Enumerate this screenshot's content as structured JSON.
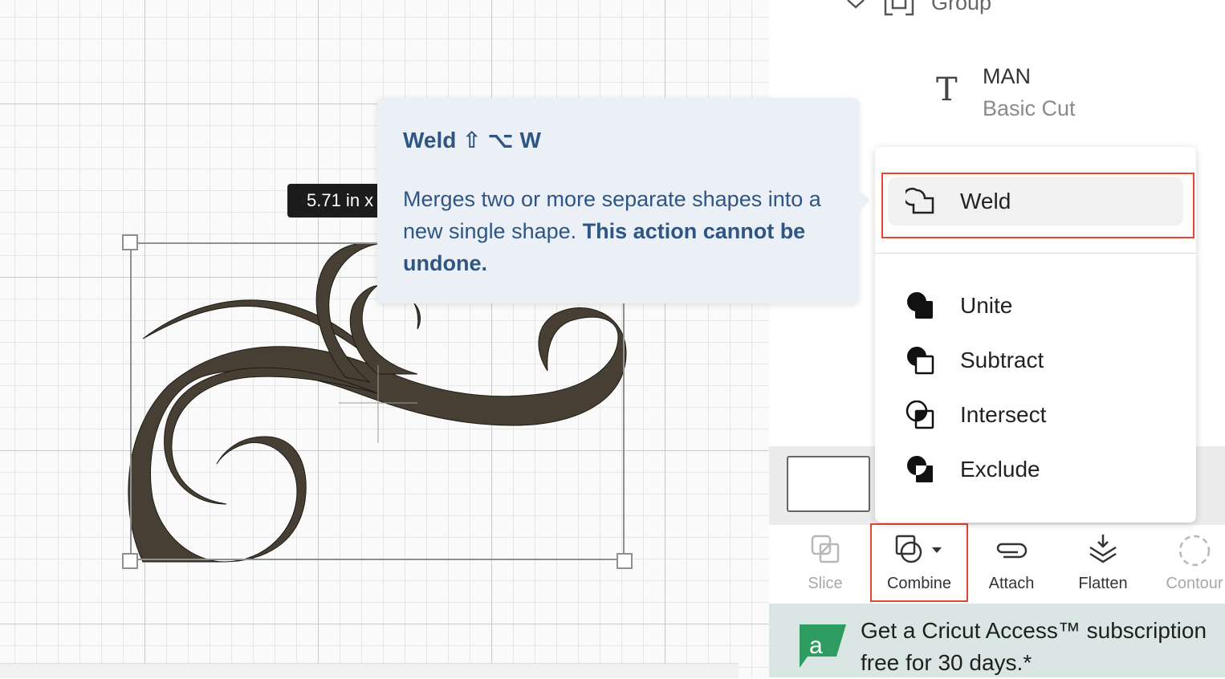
{
  "canvas": {
    "size_label": "5.71  in x"
  },
  "layers": {
    "group": {
      "label": "Group"
    },
    "text_layer": {
      "name": "MAN",
      "operation": "Basic Cut"
    }
  },
  "tooltip": {
    "title": "Weld",
    "shortcut": "⇧ ⌥ W",
    "description": "Merges two or more separate shapes into a new single shape.",
    "warning": "This action cannot be undone."
  },
  "combine_menu": {
    "items": [
      {
        "label": "Weld",
        "icon": "weld-icon"
      },
      {
        "label": "Unite",
        "icon": "unite-icon"
      },
      {
        "label": "Subtract",
        "icon": "subtract-icon"
      },
      {
        "label": "Intersect",
        "icon": "intersect-icon"
      },
      {
        "label": "Exclude",
        "icon": "exclude-icon"
      }
    ]
  },
  "toolbar": {
    "slice": "Slice",
    "combine": "Combine",
    "attach": "Attach",
    "flatten": "Flatten",
    "contour": "Contour"
  },
  "promo": {
    "text": "Get a Cricut Access™ subscription\nfree for 30 days.*"
  },
  "colors": {
    "highlight": "#e64533",
    "tooltip_bg": "#ebf0f7",
    "tooltip_text": "#2f5584",
    "design_fill": "#473f33",
    "promo_bg": "#d9e6e4",
    "access_logo": "#2e9c61"
  }
}
